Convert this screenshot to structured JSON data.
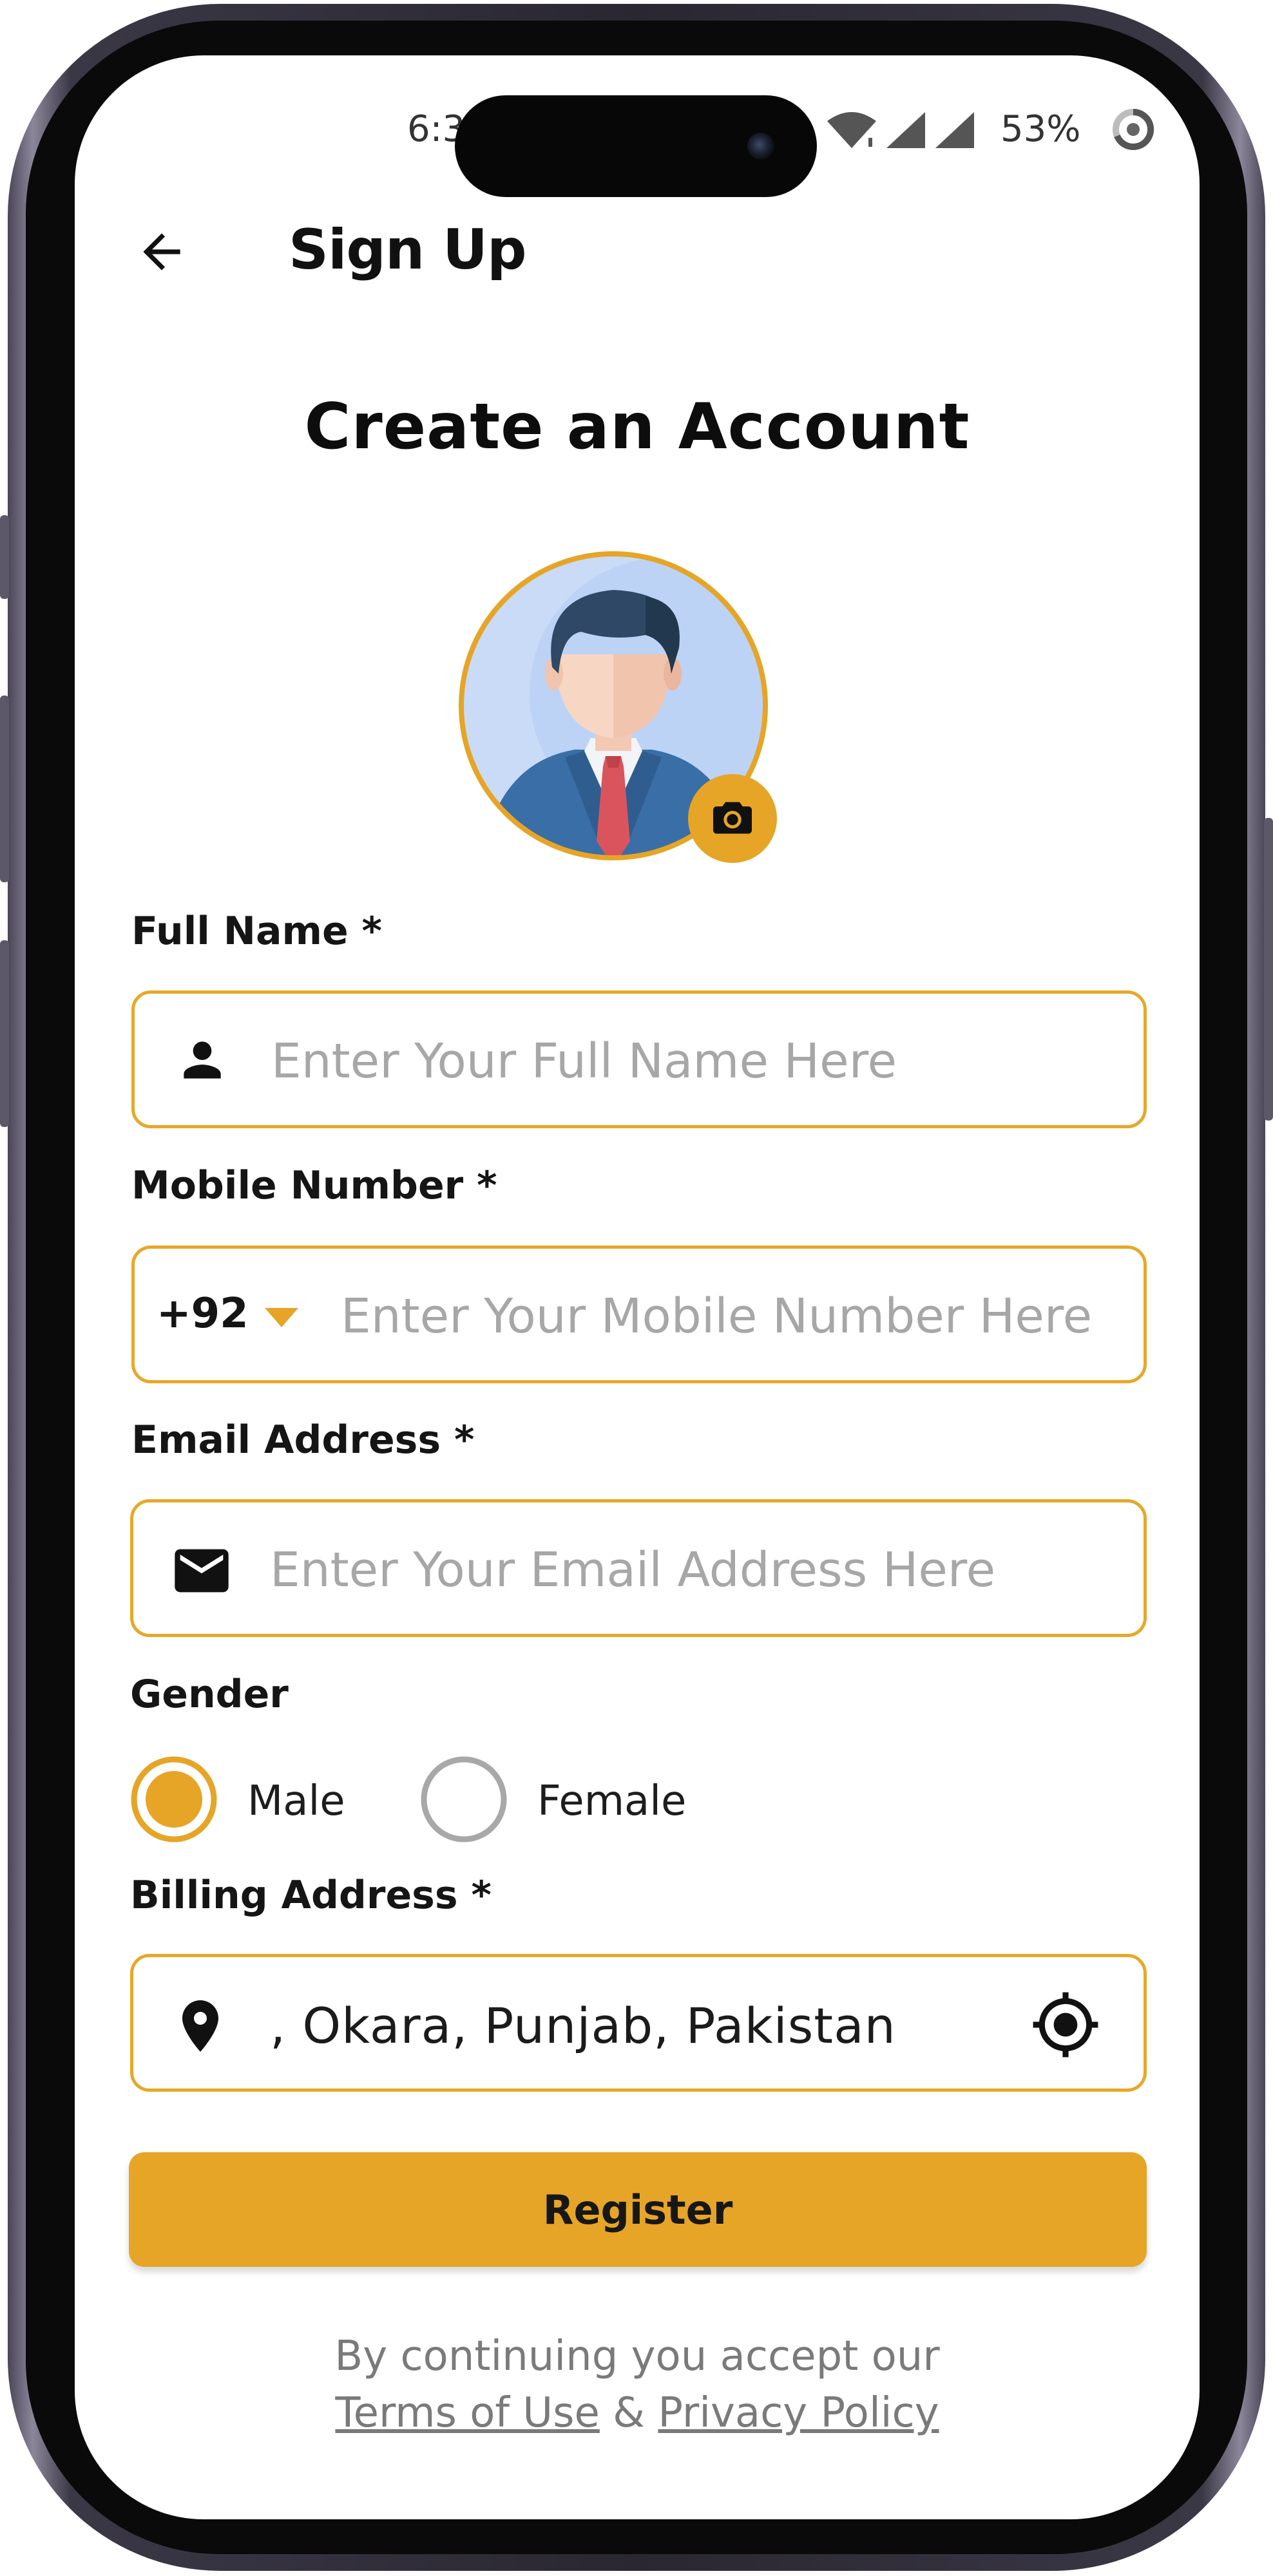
{
  "status_bar": {
    "time_partial": "6:3",
    "battery": "53%"
  },
  "header": {
    "title": "Sign Up"
  },
  "main": {
    "heading": "Create an Account",
    "form": {
      "full_name": {
        "label": "Full Name *",
        "placeholder": "Enter Your Full Name Here"
      },
      "mobile": {
        "label": "Mobile Number *",
        "country_code": "+92",
        "placeholder": "Enter Your Mobile Number Here"
      },
      "email": {
        "label": "Email Address *",
        "placeholder": "Enter Your Email Address Here"
      },
      "gender": {
        "label": "Gender",
        "options": [
          {
            "label": "Male",
            "selected": true
          },
          {
            "label": "Female",
            "selected": false
          }
        ]
      },
      "billing": {
        "label": "Billing Address *",
        "value": ", Okara, Punjab, Pakistan"
      }
    },
    "register_label": "Register",
    "footer": {
      "line1": "By continuing you accept our",
      "terms": "Terms of Use",
      "amp": "&",
      "privacy": "Privacy Policy"
    }
  },
  "colors": {
    "accent": "#e6a526",
    "field_border": "#e7a828",
    "text": "#151515",
    "placeholder": "#a7a7a7"
  },
  "icons": [
    "back-arrow-icon",
    "avatar",
    "camera-icon",
    "person-icon",
    "dropdown-triangle-icon",
    "mail-icon",
    "location-pin-icon",
    "gps-target-icon",
    "wifi-icon",
    "signal-icon",
    "battery-ring-icon"
  ]
}
